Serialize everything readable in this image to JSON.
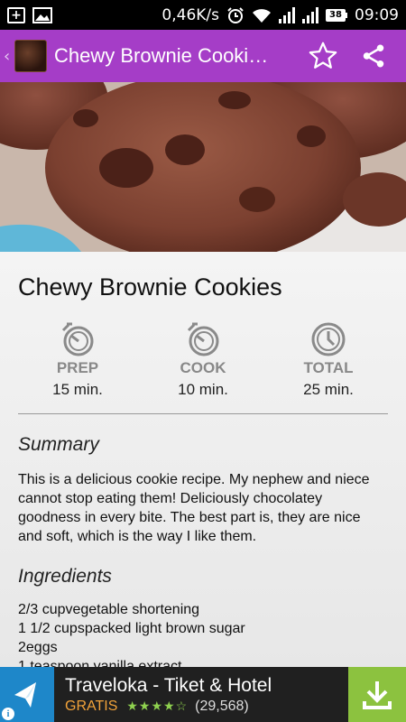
{
  "status_bar": {
    "speed": "0,46K/s",
    "battery": "38",
    "time": "09:09"
  },
  "action_bar": {
    "title": "Chewy Brownie Cooki…",
    "back_glyph": "‹"
  },
  "recipe": {
    "title": "Chewy Brownie Cookies",
    "times": [
      {
        "label": "PREP",
        "value": "15 min.",
        "icon": "timer-icon"
      },
      {
        "label": "COOK",
        "value": "10 min.",
        "icon": "timer-icon"
      },
      {
        "label": "TOTAL",
        "value": "25 min.",
        "icon": "clock-icon"
      }
    ],
    "summary_heading": "Summary",
    "summary_text": " This is a delicious cookie recipe. My nephew and niece cannot stop eating them! Deliciously chocolatey goodness in every bite. The best part is, they are nice and soft, which is the way I like them.",
    "ingredients_heading": "Ingredients",
    "ingredients": [
      "2/3 cupvegetable shortening",
      "1 1/2 cupspacked light brown sugar",
      "2eggs",
      "1 teaspoon vanilla extract"
    ]
  },
  "ad": {
    "title": "Traveloka - Tiket & Hotel",
    "price": "GRATIS",
    "stars": "★★★★☆",
    "rating_count": "(29,568)",
    "info_glyph": "i"
  },
  "colors": {
    "action_bar": "#a53dc7",
    "ad_download": "#8cc23f",
    "ad_price": "#f2a33a"
  }
}
